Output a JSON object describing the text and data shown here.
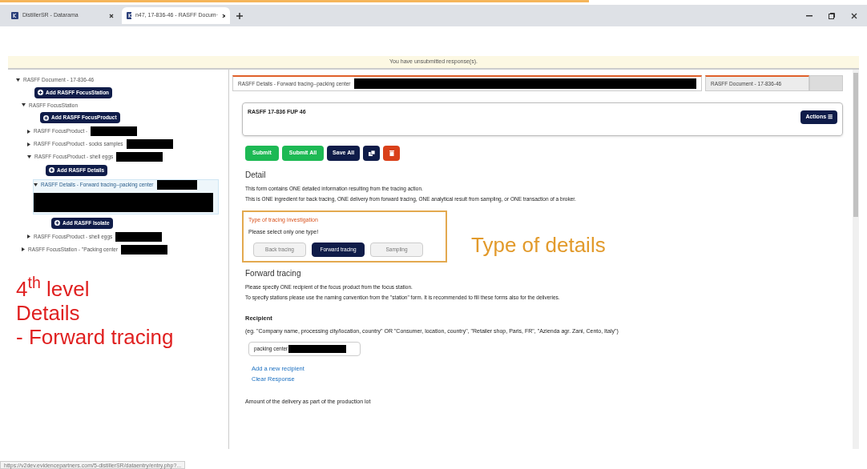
{
  "browser_tabs": [
    {
      "title": "DistillerSR - Datarama",
      "selected": false
    },
    {
      "title": "n47, 17-836-46 - RASFF Docum·",
      "selected": true
    }
  ],
  "banner": "You have unsubmitted response(s).",
  "tree": [
    {
      "kind": "node",
      "label": "RASFF Document - 17-836-46",
      "expanded": true,
      "redacted": false,
      "selected": false,
      "children": [
        {
          "kind": "add",
          "label": "Add RASFF FocusStation"
        },
        {
          "kind": "node",
          "label": "RASFF FocusStation",
          "expanded": true,
          "redacted": false,
          "selected": false,
          "children": [
            {
              "kind": "add",
              "label": "Add RASFF FocusProduct"
            },
            {
              "kind": "node",
              "label": "RASFF FocusProduct -",
              "expanded": false,
              "redacted": true,
              "selected": false
            },
            {
              "kind": "node",
              "label": "RASFF FocusProduct - socks samples",
              "expanded": false,
              "redacted": true,
              "selected": false
            },
            {
              "kind": "node",
              "label": "RASFF FocusProduct - shell eggs",
              "expanded": true,
              "redacted": true,
              "selected": false,
              "children": [
                {
                  "kind": "add",
                  "label": "Add RASFF Details"
                },
                {
                  "kind": "node",
                  "label": "RASFF Details - Forward tracing--packing center",
                  "expanded": true,
                  "redacted": true,
                  "selected": true,
                  "children": [
                    {
                      "kind": "add",
                      "label": "Add RASFF Isolate"
                    }
                  ]
                }
              ]
            },
            {
              "kind": "node",
              "label": "RASFF FocusProduct - shell eggs",
              "expanded": false,
              "redacted": true,
              "selected": false
            }
          ]
        },
        {
          "kind": "node",
          "label": "RASFF FocusStation - \"Packing center",
          "expanded": false,
          "redacted": true,
          "selected": false
        }
      ]
    }
  ],
  "annotation_left": [
    "4$^{th}$ level",
    "Details",
    "- Forward tracing"
  ],
  "annotation_right": "Type of details",
  "doc_tabs": [
    {
      "title": "RASFF Details - Forward tracing--packing center",
      "selected": true,
      "redacted": true
    },
    {
      "title": "RASFF Document - 17-836-46",
      "selected": false,
      "redacted": false
    }
  ],
  "record_title": "RASFF 17-836 FUP 46",
  "actions_button": "Actions ☰",
  "buttons": [
    {
      "kind": "green",
      "label": "Submit"
    },
    {
      "kind": "green",
      "label": "Submit All"
    },
    {
      "kind": "navy",
      "label": "Save All"
    },
    {
      "kind": "copy"
    },
    {
      "kind": "delete"
    }
  ],
  "detail": {
    "heading": "Detail",
    "lines": [
      "This form contains ONE detailed information resulting from the tracing action.",
      "This is ONE ingredient for back tracing, ONE delivery from forward tracing, ONE analytical result from sampling, or ONE transaction of a broker."
    ]
  },
  "tracing_type": {
    "title": "Type of tracing investigation",
    "hint": "Please select only one type!",
    "options": [
      {
        "label": "Back tracing",
        "selected": false
      },
      {
        "label": "Forward tracing",
        "selected": true
      },
      {
        "label": "Sampling",
        "selected": false
      }
    ]
  },
  "forward": {
    "heading": "Forward tracing",
    "lines": [
      "Please specify ONE recipient of the focus product from the focus station.",
      "To specify stations please use the naming convention from the \"station\" form. It is recommended to fill these forms also for the deliveries."
    ]
  },
  "recipient": {
    "label": "Recipient",
    "hint": "(eg. \"Company name, processing city/location, country\" OR \"Consumer, location, country\", \"Retailer shop, Paris, FR\", \"Azienda agr. Zani, Cento, Italy\")",
    "value": "packing center",
    "redacted": true,
    "links": [
      "Add a new recipient",
      "Clear Response"
    ]
  },
  "amount_label": "Amount of the delivery as part of the production lot",
  "status_url": "https://v2dev.evidencepartners.com/5-distillerSR/dataentry/entry.php?..."
}
